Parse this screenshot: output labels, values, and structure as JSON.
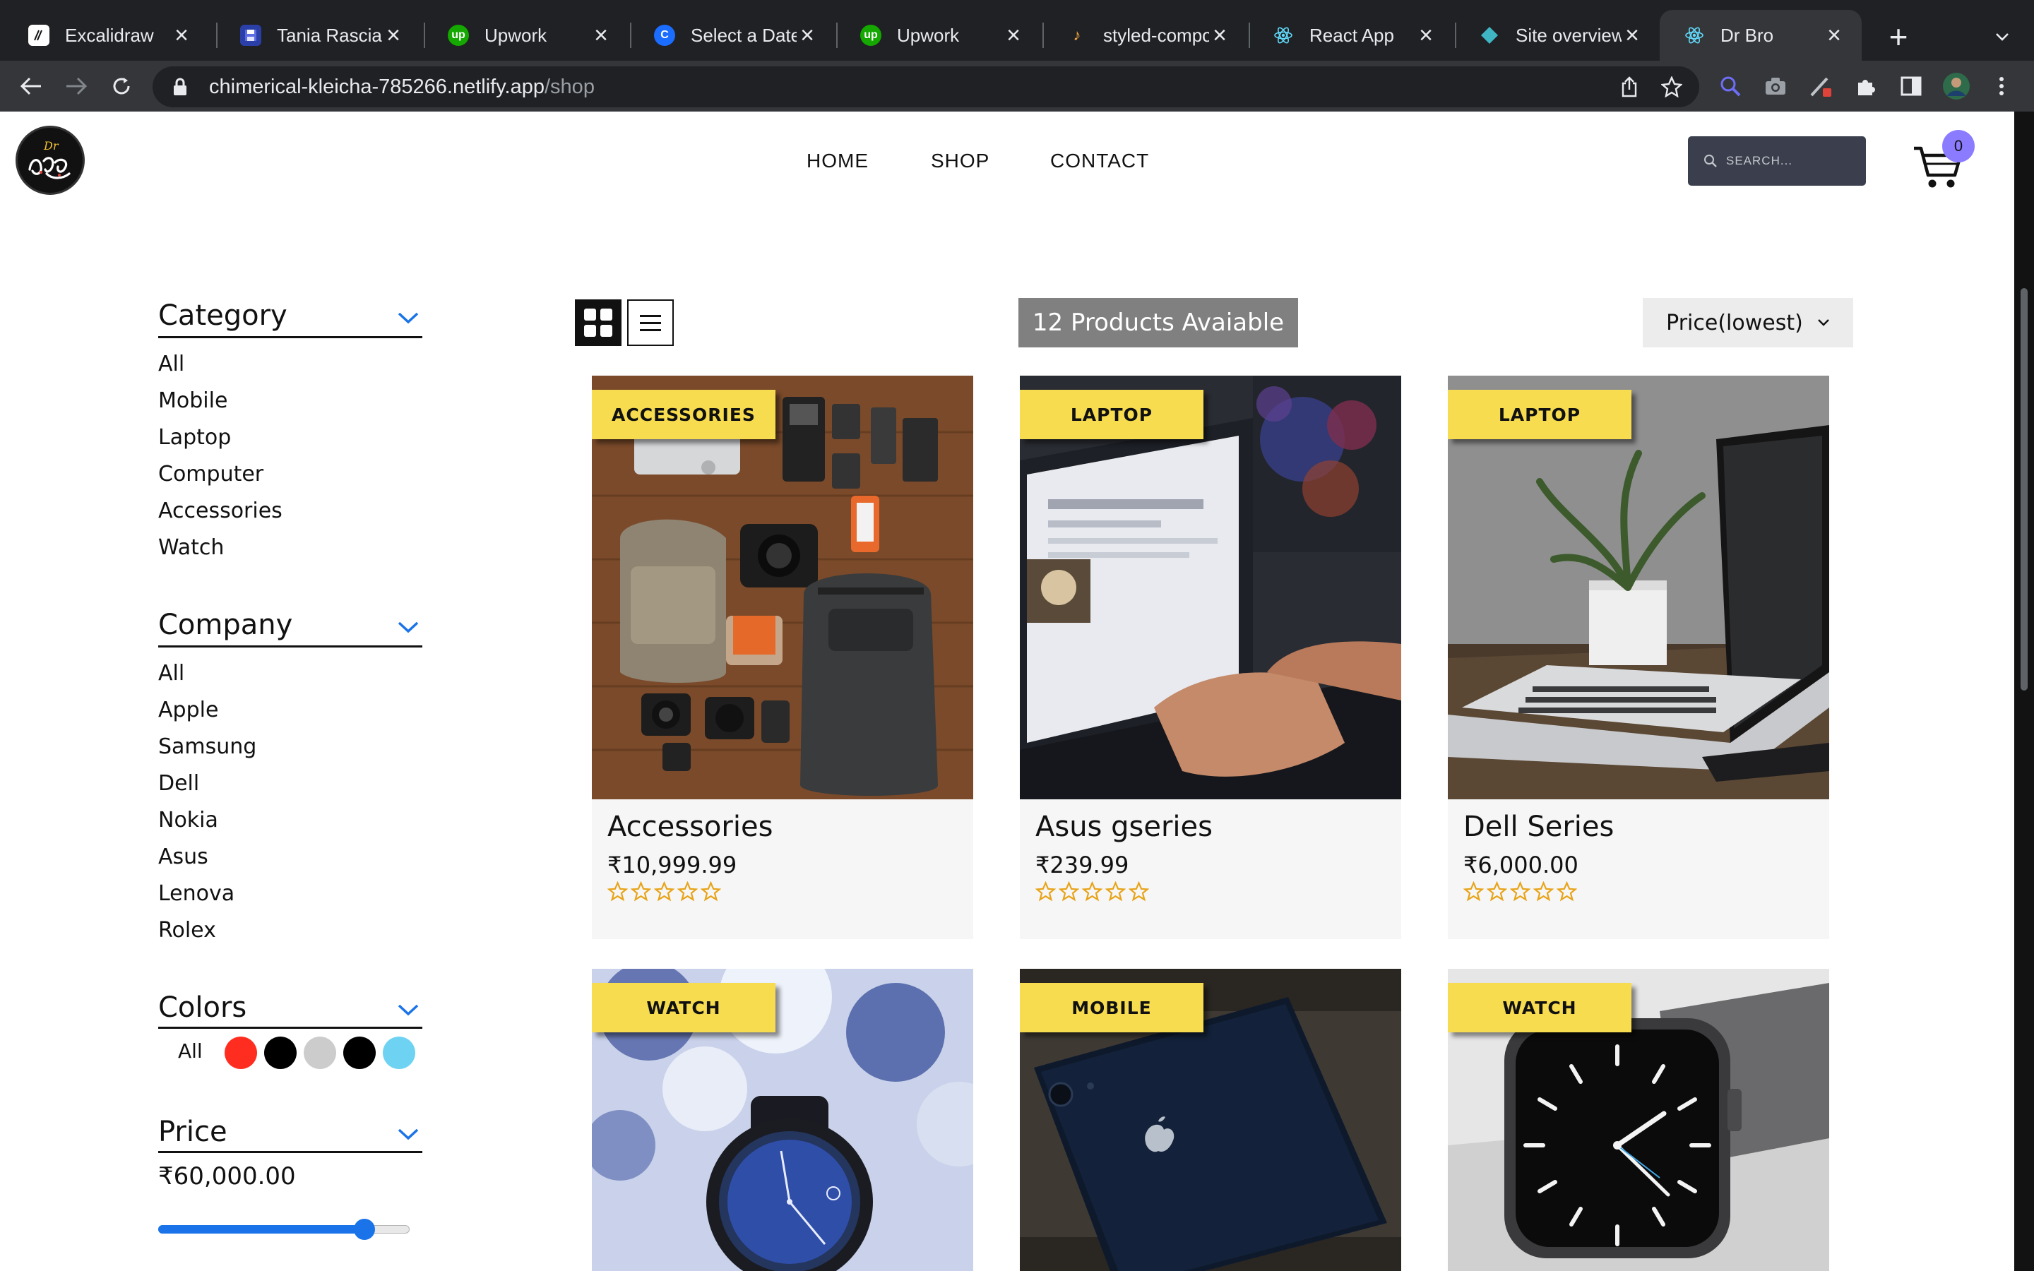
{
  "browser": {
    "tabs": [
      {
        "title": "Excalidraw",
        "icon": "excalidraw-icon"
      },
      {
        "title": "Tania Rascia",
        "icon": "floppy-disk-icon"
      },
      {
        "title": "Upwork",
        "icon": "upwork-icon"
      },
      {
        "title": "Select a Date ...",
        "icon": "calendly-icon"
      },
      {
        "title": "Upwork",
        "icon": "upwork-icon"
      },
      {
        "title": "styled-compo...",
        "icon": "styled-components-icon"
      },
      {
        "title": "React App",
        "icon": "react-icon"
      },
      {
        "title": "Site overview ...",
        "icon": "netlify-icon"
      },
      {
        "title": "Dr Bro",
        "icon": "react-icon",
        "active": true
      }
    ],
    "url_host": "chimerical-kleicha-785266.netlify.app",
    "url_path": "/shop"
  },
  "site": {
    "logo_alt": "Dr Bro",
    "nav": [
      "HOME",
      "SHOP",
      "CONTACT"
    ],
    "search_placeholder": "SEARCH...",
    "cart_count": "0"
  },
  "filters": {
    "category": {
      "title": "Category",
      "items": [
        "All",
        "Mobile",
        "Laptop",
        "Computer",
        "Accessories",
        "Watch"
      ]
    },
    "company": {
      "title": "Company",
      "items": [
        "All",
        "Apple",
        "Samsung",
        "Dell",
        "Nokia",
        "Asus",
        "Lenova",
        "Rolex"
      ]
    },
    "colors": {
      "title": "Colors",
      "all_label": "All",
      "swatches": [
        "#ff2d1f",
        "#000000",
        "#cccccc",
        "#000000",
        "#6ed3f2"
      ]
    },
    "price": {
      "title": "Price",
      "value": "₹60,000.00",
      "fraction": 0.82
    }
  },
  "products_bar": {
    "count_label": "12 Products Avaiable",
    "sort_label": "Price(lowest)"
  },
  "products": [
    {
      "category": "ACCESSORIES",
      "name": "Accessories",
      "price": "₹10,999.99",
      "rating": 0
    },
    {
      "category": "LAPTOP",
      "name": "Asus gseries",
      "price": "₹239.99",
      "rating": 0
    },
    {
      "category": "LAPTOP",
      "name": "Dell Series",
      "price": "₹6,000.00",
      "rating": 0
    },
    {
      "category": "WATCH",
      "name": "",
      "price": "",
      "rating": 0
    },
    {
      "category": "MOBILE",
      "name": "",
      "price": "",
      "rating": 0
    },
    {
      "category": "WATCH",
      "name": "",
      "price": "",
      "rating": 0
    }
  ],
  "colors": {
    "badge": "#f6dc4e",
    "accent": "#1a73e8",
    "star": "#e8a317",
    "cart_badge": "#8b7cff"
  }
}
